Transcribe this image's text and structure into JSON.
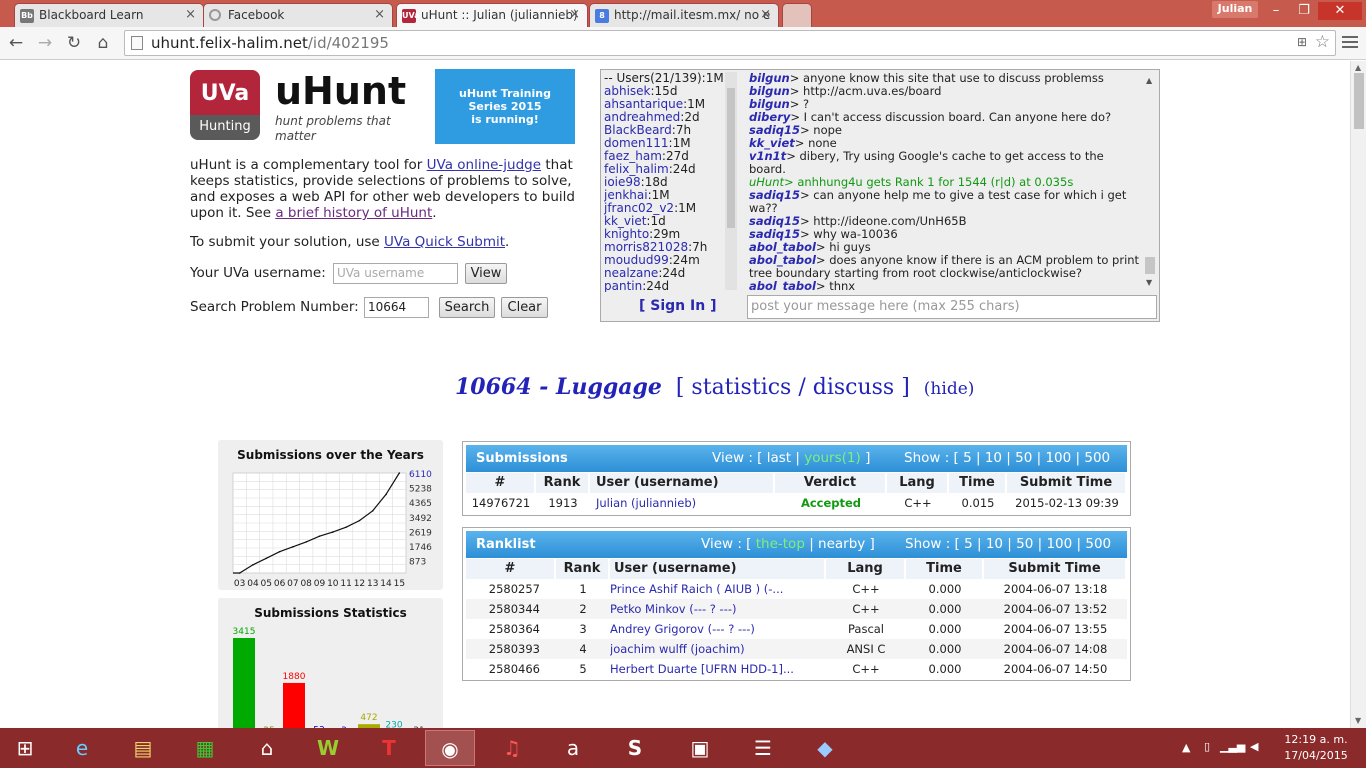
{
  "browser": {
    "tabs": [
      {
        "title": "Blackboard Learn",
        "icon": "Bb"
      },
      {
        "title": "Facebook",
        "icon": "loading"
      },
      {
        "title": "uHunt :: Julian (juliannieb)",
        "icon": "UVa"
      },
      {
        "title": "http://mail.itesm.mx/ no e",
        "icon": "8"
      }
    ],
    "user": "Julian",
    "url_host": "uhunt.felix-halim.net",
    "url_path": "/id/402195"
  },
  "header": {
    "logo_top": "UVa",
    "logo_bottom": "Hunting",
    "brand": "uHunt",
    "tagline": "hunt problems that matter",
    "banner": [
      "uHunt Training",
      "Series 2015",
      "is running!"
    ],
    "intro_1": "uHunt is a complementary tool for ",
    "intro_link1": "UVa online-judge",
    "intro_2": " that keeps statistics, provide selections of problems to solve, and exposes a web API for other web developers to build upon it. See ",
    "intro_link2": "a brief history of uHunt",
    "intro_3": ".",
    "submit_text": "To submit your solution, use ",
    "submit_link": "UVa Quick Submit",
    "submit_end": ".",
    "username_label": "Your UVa username:",
    "username_placeholder": "UVa username",
    "view_button": "View",
    "search_label": "Search Problem Number:",
    "search_value": "10664",
    "search_button": "Search",
    "clear_button": "Clear"
  },
  "chat": {
    "users_header": "-- Users(21/139):1M",
    "users": [
      {
        "name": "abhisek",
        "t": ":15d"
      },
      {
        "name": "ahsantarique",
        "t": ":1M"
      },
      {
        "name": "andreahmed",
        "t": ":2d"
      },
      {
        "name": "BlackBeard",
        "t": ":7h"
      },
      {
        "name": "domen111",
        "t": ":1M"
      },
      {
        "name": "faez_ham",
        "t": ":27d"
      },
      {
        "name": "felix_halim",
        "t": ":24d"
      },
      {
        "name": "ioie98",
        "t": ":18d"
      },
      {
        "name": "jenkhai",
        "t": ":1M"
      },
      {
        "name": "jfranc02_v2",
        "t": ":1M"
      },
      {
        "name": "kk_viet",
        "t": ":1d"
      },
      {
        "name": "knighto",
        "t": ":29m"
      },
      {
        "name": "morris821028",
        "t": ":7h"
      },
      {
        "name": "moudud99",
        "t": ":24m"
      },
      {
        "name": "nealzane",
        "t": ":24d"
      },
      {
        "name": "pantin",
        "t": ":24d"
      }
    ],
    "sign_in": "[ Sign In ]",
    "messages": [
      {
        "user": "bilgun",
        "text": "> anyone know this site that use to discuss problemss"
      },
      {
        "user": "bilgun",
        "text": "> http://acm.uva.es/board"
      },
      {
        "user": "bilgun",
        "text": "> ?"
      },
      {
        "user": "dibery",
        "text": "> I can't access discussion board. Can anyone here do?"
      },
      {
        "user": "sadiq15",
        "text": "> nope"
      },
      {
        "user": "kk_viet",
        "text": "> none"
      },
      {
        "user": "v1n1t",
        "text": "> dibery, Try using Google's cache to get access to the board."
      },
      {
        "user": "uHunt",
        "text": "> anhhung4u gets Rank 1 for 1544 (r|d) at 0.035s",
        "system": true
      },
      {
        "user": "sadiq15",
        "text": "> can anyone help me to give a test case for which i get wa??"
      },
      {
        "user": "sadiq15",
        "text": "> http://ideone.com/UnH65B"
      },
      {
        "user": "sadiq15",
        "text": "> why wa-10036"
      },
      {
        "user": "abol_tabol",
        "text": "> hi guys"
      },
      {
        "user": "abol_tabol",
        "text": "> does anyone know if there is an ACM problem to print tree boundary starting from root clockwise/anticlockwise?"
      },
      {
        "user": "abol_tabol",
        "text": "> thnx"
      }
    ],
    "input_placeholder": "post your message here (max 255 chars)"
  },
  "problem": {
    "title": "10664 - Luggage",
    "links": "[ statistics / discuss ]",
    "hide": "(hide)"
  },
  "chart_data": [
    {
      "type": "line",
      "title": "Submissions over the Years",
      "x": [
        "03",
        "04",
        "05",
        "06",
        "07",
        "08",
        "09",
        "10",
        "11",
        "12",
        "13",
        "14",
        "15"
      ],
      "y_ticks": [
        "6110",
        "5238",
        "4365",
        "3492",
        "2619",
        "1746",
        "873"
      ],
      "values": [
        0,
        500,
        900,
        1300,
        1600,
        1900,
        2250,
        2500,
        2800,
        3200,
        3800,
        4800,
        6110
      ],
      "ylim": [
        0,
        6110
      ]
    },
    {
      "type": "bar",
      "title": "Submissions Statistics",
      "values": [
        3415,
        25,
        1880,
        53,
        3,
        472,
        230,
        31
      ],
      "colors": [
        "#00aa00",
        "#888800",
        "#ff0000",
        "#0000cc",
        "#0000cc",
        "#aaaa00",
        "#00aaaa",
        "#333333"
      ]
    }
  ],
  "submissions": {
    "title": "Submissions",
    "view": "View : [",
    "view_last": "last",
    "view_sep": "|",
    "view_yours": "yours(1)",
    "view_end": "]",
    "show": "Show : [ 5 | 10 | 50 | 100 | 500",
    "headers": [
      "#",
      "Rank",
      "User (username)",
      "Verdict",
      "Lang",
      "Time",
      "Submit Time"
    ],
    "rows": [
      [
        "14976721",
        "1913",
        "Julian (juliannieb)",
        "Accepted",
        "C++",
        "0.015",
        "2015-02-13 09:39"
      ]
    ]
  },
  "ranklist": {
    "title": "Ranklist",
    "view": "View : [",
    "view_top": "the-top",
    "view_nearby": "| nearby ]",
    "show": "Show : [ 5 | 10 | 50 | 100 | 500",
    "headers": [
      "#",
      "Rank",
      "User (username)",
      "Lang",
      "Time",
      "Submit Time"
    ],
    "rows": [
      [
        "2580257",
        "1",
        "Prince Ashif Raich ( AIUB ) (-...",
        "C++",
        "0.000",
        "2004-06-07 13:18"
      ],
      [
        "2580344",
        "2",
        "Petko Minkov (--- ? ---)",
        "C++",
        "0.000",
        "2004-06-07 13:52"
      ],
      [
        "2580364",
        "3",
        "Andrey Grigorov (--- ? ---)",
        "Pascal",
        "0.000",
        "2004-06-07 13:55"
      ],
      [
        "2580393",
        "4",
        "joachim wulff (joachim)",
        "ANSI C",
        "0.000",
        "2004-06-07 14:08"
      ],
      [
        "2580466",
        "5",
        "Herbert Duarte [UFRN HDD-1]...",
        "C++",
        "0.000",
        "2004-06-07 14:50"
      ]
    ]
  },
  "taskbar": {
    "time": "12:19 a. m.",
    "date": "17/04/2015",
    "apps": [
      "windows-icon",
      "ie-icon",
      "explorer-icon",
      "store-icon",
      "home-icon",
      "word-icon",
      "t-icon",
      "chrome-icon",
      "itunes-icon",
      "amazon-icon",
      "s-icon",
      "sublime-icon",
      "eclipse-icon",
      "box-icon"
    ]
  }
}
